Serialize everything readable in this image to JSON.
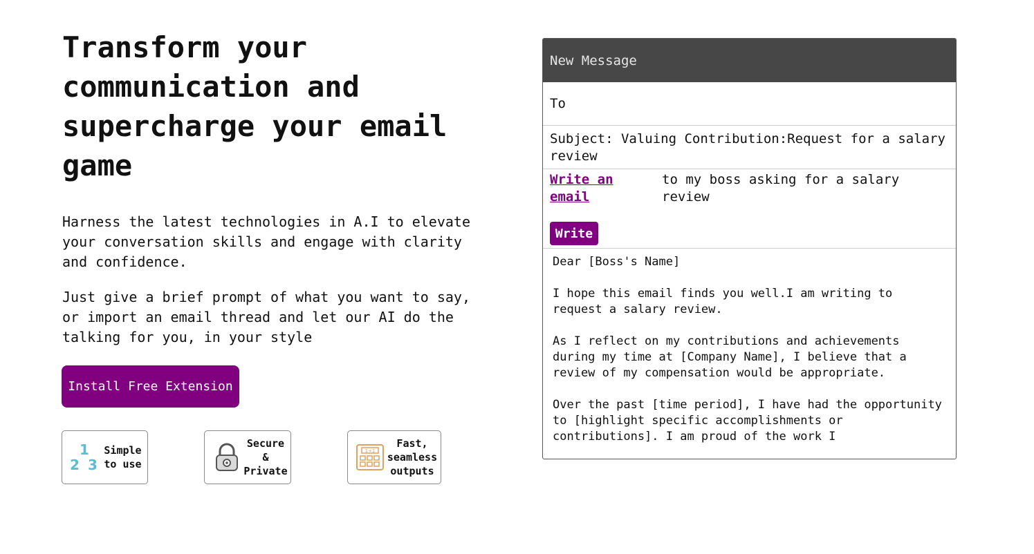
{
  "hero": {
    "title": "Transform your communication and supercharge your email game",
    "paragraph1": "Harness the latest technologies in A.I to elevate your conversation skills and engage with clarity and confidence.",
    "paragraph2": "Just give a brief prompt of what you want to say, or import an email thread and let our AI do the talking for you, in your style",
    "install_label": "Install Free Extension"
  },
  "features": [
    {
      "icon": "numbers-123-icon",
      "label": "Simple to use"
    },
    {
      "icon": "padlock-icon",
      "label": "Secure & Private"
    },
    {
      "icon": "calculator-icon",
      "label": "Fast, seamless outputs"
    }
  ],
  "compose": {
    "header": "New Message",
    "to_label": "To",
    "subject": "Subject: Valuing Contribution:Request for a salary review",
    "write_link": "Write an email",
    "prompt": "to my boss asking for a salary review",
    "write_button": "Write",
    "body": [
      "Dear [Boss's Name]",
      "I hope this email finds you well.I am writing to request a salary review.",
      "As I reflect on my contributions and achievements during my time at [Company Name], I believe that a review of my compensation would be appropriate.",
      "Over the past [time period], I have had the opportunity to [highlight specific accomplishments or contributions]. I am proud of the work I"
    ]
  },
  "colors": {
    "brand": "#800080",
    "header_bg": "#474747",
    "icon_blue": "#5bbcd6",
    "icon_orange": "#e0a060"
  }
}
